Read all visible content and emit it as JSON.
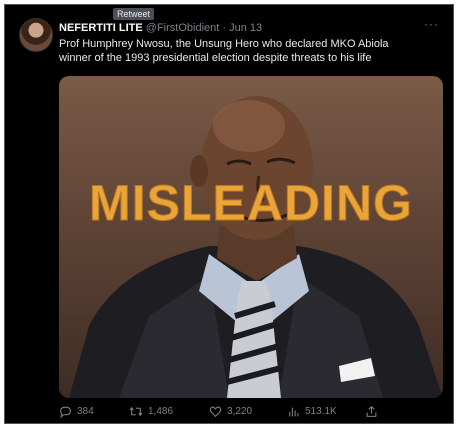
{
  "tooltip": "Retweet",
  "author": {
    "name": "NEFERTITI LITE",
    "handle": "@FirstObidient",
    "separator": "·",
    "date": "Jun 13"
  },
  "more": "···",
  "tweet_text": "Prof Humphrey Nwosu, the Unsung Hero who declared MKO Abiola winner of the 1993 presidential election despite threats to his life",
  "media": {
    "overlay_label": "MISLEADING",
    "overlay_color": "#e9a43a"
  },
  "actions": {
    "replies": "384",
    "retweets": "1,486",
    "likes": "3,220",
    "views": "513.1K"
  },
  "icons": {
    "reply": "reply-icon",
    "retweet": "retweet-icon",
    "like": "heart-icon",
    "views": "views-icon",
    "share": "share-icon"
  }
}
